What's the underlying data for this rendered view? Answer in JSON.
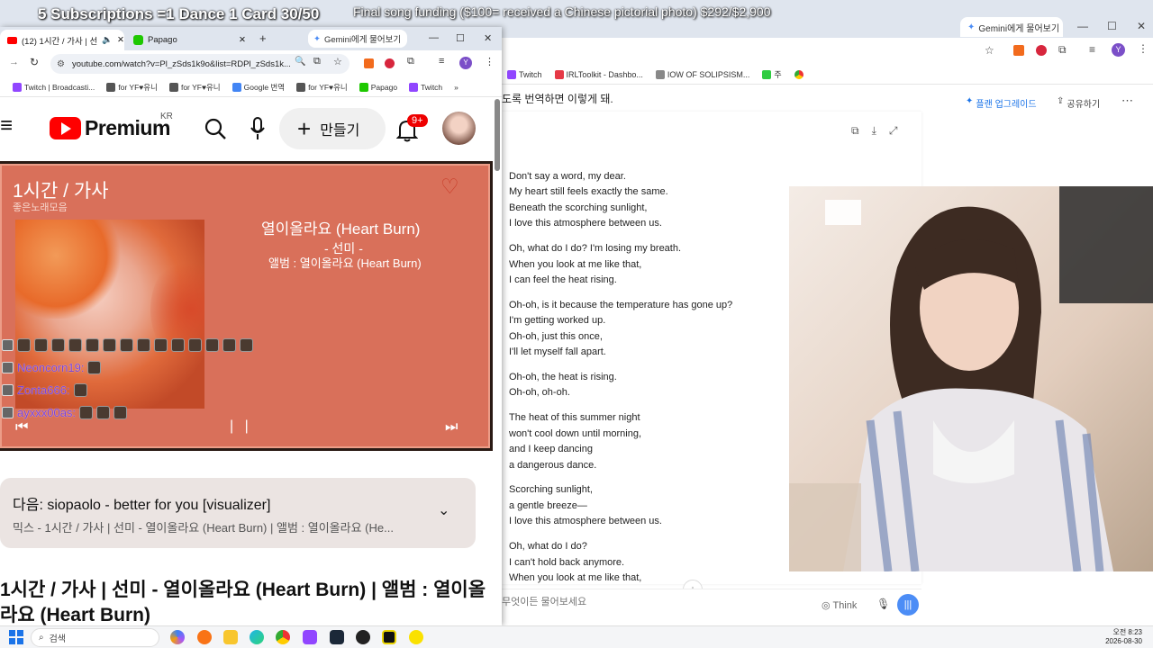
{
  "overlay": {
    "left_text": "5 Subscriptions =1 Dance 1 Card 30/50",
    "right_text": "Final song funding ($100= received a Chinese pictorial photo) $292/$2,900"
  },
  "back_browser": {
    "gemini_tab": "Gemini에게 물어보기",
    "bookmarks": [
      "Twitch",
      "IRLToolkit - Dashbo...",
      "IOW OF SOLIPSISM...",
      "주"
    ],
    "gemini": {
      "top_text": "도록 번역하면 이렇게 돼.",
      "upgrade": "플랜 업그레이드",
      "share": "공유하기",
      "lyrics": [
        [
          "Don't say a word, my dear.",
          "My heart still feels exactly the same.",
          "Beneath the scorching sunlight,",
          "I love this atmosphere between us."
        ],
        [
          "Oh, what do I do? I'm losing my breath.",
          "When you look at me like that,",
          "I can feel the heat rising."
        ],
        [
          "Oh-oh, is it because the temperature has gone up?",
          "I'm getting worked up.",
          "Oh-oh, just this once,",
          "I'll let myself fall apart."
        ],
        [
          "Oh-oh, the heat is rising.",
          "Oh-oh, oh-oh."
        ],
        [
          "The heat of this summer night",
          "won't cool down until morning,",
          "and I keep dancing",
          "a dangerous dance."
        ],
        [
          "Scorching sunlight,",
          "a gentle breeze—",
          "I love this atmosphere between us."
        ],
        [
          "Oh, what do I do?",
          "I can't hold back anymore.",
          "When you look at me like that,"
        ]
      ],
      "input_placeholder": "무엇이든 물어보세요",
      "think_label": "Think"
    }
  },
  "front_browser": {
    "tabs": [
      {
        "label": "(12) 1시간 / 가사 | 선"
      },
      {
        "label": "Papago"
      }
    ],
    "gemini_tab": "Gemini에게 물어보기",
    "url": "youtube.com/watch?v=Pl_zSds1k9o&list=RDPl_zSds1k...",
    "bookmarks": [
      "Twitch | Broadcasti...",
      "for YF♥유니",
      "for YF♥유니",
      "Google 번역",
      "for YF♥유니",
      "Papago",
      "Twitch"
    ],
    "youtube": {
      "brand": "Premium",
      "region": "KR",
      "create_label": "만들기",
      "notif_count": "9+",
      "player": {
        "title": "1시간 / 가사",
        "subtitle": "좋은노래모음",
        "song": "열이올라요 (Heart Burn)",
        "artist": "- 선미 -",
        "album": "앨범 : 열이올라요 (Heart Burn)"
      },
      "chat": [
        {
          "user": "",
          "emotes": 14
        },
        {
          "user": "Neoncorn19:",
          "emotes": 1
        },
        {
          "user": "Zonta666:",
          "emotes": 1
        },
        {
          "user": "ayxxx00as:",
          "emotes": 3
        }
      ],
      "up_next": {
        "title": "다음: siopaolo - better for you [visualizer]",
        "subtitle": "믹스 - 1시간 / 가사 | 선미 - 열이올라요 (Heart Burn) | 앨범 : 열이올라요 (He..."
      },
      "video_title": "1시간 / 가사 | 선미 - 열이올라요 (Heart Burn) | 앨범 : 열이올라요 (Heart Burn)"
    }
  },
  "taskbar": {
    "search_label": "검색",
    "time": "오전 8:23",
    "date": "2026-08-30"
  }
}
